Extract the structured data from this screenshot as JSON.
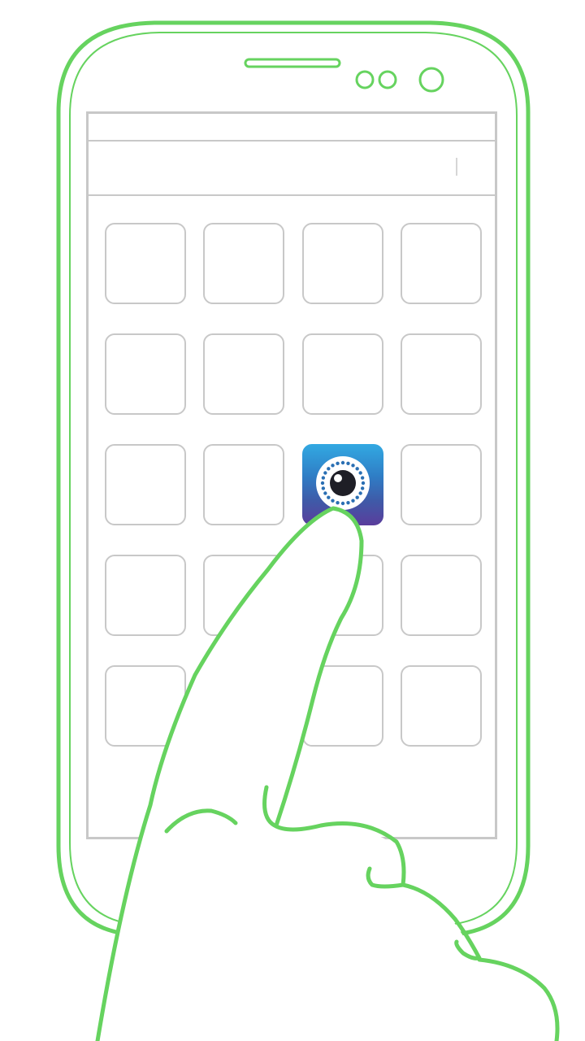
{
  "colors": {
    "outline": "#66d35f",
    "screen_border": "#c8c8c8",
    "icon_top": "#32a9e2",
    "icon_bottom": "#5a3d9c"
  },
  "home_screen": {
    "grid": {
      "rows": 5,
      "columns": 4
    },
    "highlighted_app": {
      "row": 3,
      "column": 3,
      "icon": "camera-eye-icon"
    }
  },
  "gesture": {
    "type": "tap",
    "target_icon": "camera-eye-icon",
    "hand_icon": "pointing-hand-icon"
  }
}
